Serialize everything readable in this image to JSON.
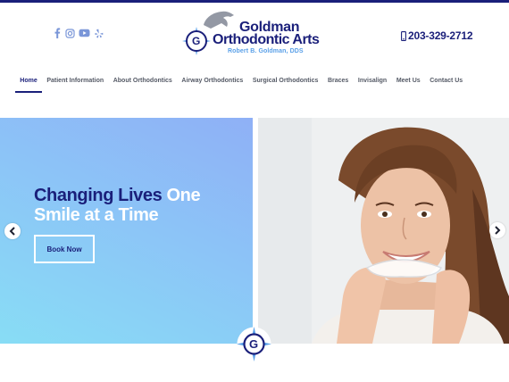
{
  "colors": {
    "brand_navy": "#1a1f7a",
    "brand_light_blue": "#5aa0e8",
    "hero_gradient_top": "#8fb0f6",
    "hero_gradient_bottom": "#88ddf5"
  },
  "header": {
    "social": [
      {
        "icon": "facebook-icon"
      },
      {
        "icon": "instagram-icon"
      },
      {
        "icon": "youtube-icon"
      },
      {
        "icon": "yelp-icon"
      }
    ],
    "logo": {
      "line1": "Goldman",
      "line2": "Orthodontic Arts",
      "line3": "Robert B. Goldman, DDS",
      "letter": "G"
    },
    "phone": {
      "icon": "phone-icon",
      "number": "203-329-2712"
    }
  },
  "nav": {
    "items": [
      {
        "label": "Home",
        "active": true
      },
      {
        "label": "Patient Information"
      },
      {
        "label": "About Orthodontics"
      },
      {
        "label": "Airway Orthodontics"
      },
      {
        "label": "Surgical Orthodontics"
      },
      {
        "label": "Braces"
      },
      {
        "label": "Invisalign"
      },
      {
        "label": "Meet Us"
      },
      {
        "label": "Contact Us"
      }
    ]
  },
  "hero": {
    "headline_dark_1": "Changing Lives",
    "headline_light_1": "One",
    "headline_light_2": "Smile at a Time",
    "cta": "Book Now",
    "prev_icon": "chevron-left-icon",
    "next_icon": "chevron-right-icon",
    "badge_letter": "G"
  }
}
